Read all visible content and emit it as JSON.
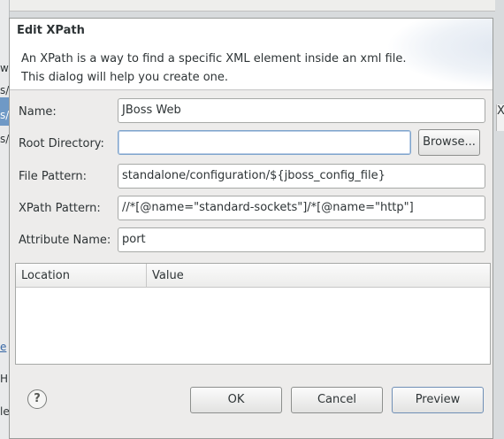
{
  "background": {
    "fragments": [
      "s/",
      "w",
      "s/",
      "s/",
      "e",
      "H",
      "le"
    ],
    "right_fragment": "X"
  },
  "dialog": {
    "title": "Edit XPath",
    "description_line1": "An XPath is a way to find a specific XML element inside an xml file.",
    "description_line2": "This dialog will help you create one."
  },
  "form": {
    "name_label": "Name:",
    "name_value": "JBoss Web",
    "root_label": "Root Directory:",
    "root_value": "",
    "browse_label": "Browse...",
    "file_pattern_label": "File Pattern:",
    "file_pattern_value": "standalone/configuration/${jboss_config_file}",
    "xpath_label": "XPath Pattern:",
    "xpath_value": "//*[@name=\"standard-sockets\"]/*[@name=\"http\"]",
    "attribute_label": "Attribute Name:",
    "attribute_value": "port"
  },
  "table": {
    "columns": [
      "Location",
      "Value"
    ],
    "rows": []
  },
  "buttons": {
    "ok": "OK",
    "cancel": "Cancel",
    "preview": "Preview",
    "help": "?"
  }
}
